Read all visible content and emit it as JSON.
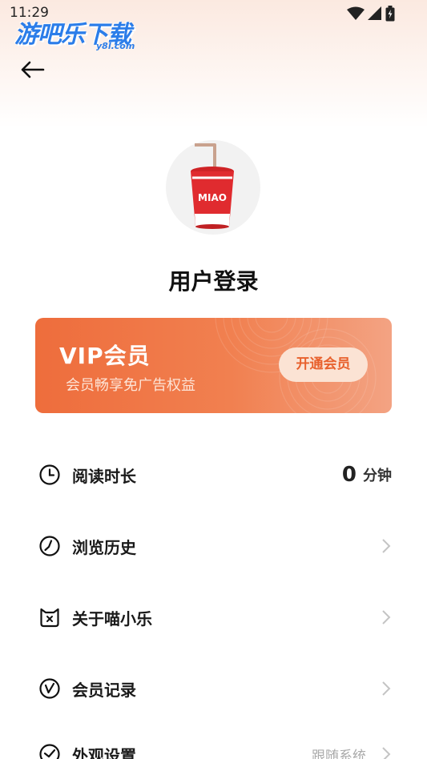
{
  "status_bar": {
    "time": "11:29"
  },
  "watermark": {
    "text": "游吧乐下载",
    "sub": "y8l.com"
  },
  "header": {
    "back_icon": "arrow-left-icon"
  },
  "profile": {
    "avatar_icon": "cup-icon",
    "avatar_badge": "MIAO",
    "login_label": "用户登录"
  },
  "vip": {
    "title": "VIP会员",
    "subtitle": "会员畅享免广告权益",
    "button_label": "开通会员",
    "colors": {
      "card_start": "#ee6d3c",
      "card_end": "#f3a383",
      "button_bg": "#fbe3d4",
      "button_text": "#e8602c"
    }
  },
  "menu": {
    "items": [
      {
        "icon": "clock-icon",
        "label": "阅读时长",
        "value": "0",
        "unit": "分钟"
      },
      {
        "icon": "history-icon",
        "label": "浏览历史"
      },
      {
        "icon": "cat-face-icon",
        "label": "关于喵小乐"
      },
      {
        "icon": "member-record-icon",
        "label": "会员记录"
      },
      {
        "icon": "appearance-icon",
        "label": "外观设置",
        "value": "跟随系统"
      }
    ]
  }
}
